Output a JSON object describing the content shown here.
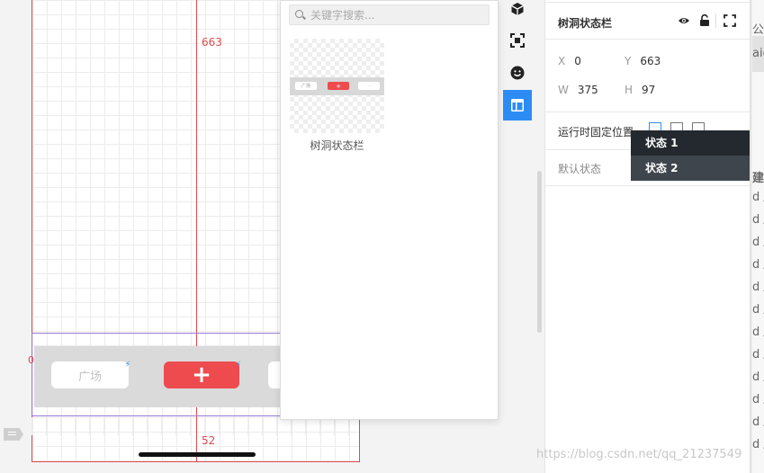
{
  "canvas": {
    "top_measure": "663",
    "bottom_measure": "52",
    "zero_mark": "0",
    "tabbar": {
      "left_label": "广场",
      "center_label": "+"
    }
  },
  "component_panel": {
    "search_placeholder": "关键字搜索...",
    "thumb_left": "广场",
    "thumb_center": "+",
    "thumb_right": "· · ·",
    "component_label": "树洞状态栏"
  },
  "rail": {
    "icons": [
      "cube-icon",
      "scan-icon",
      "smiley-icon",
      "layout-icon"
    ],
    "active": "layout-icon"
  },
  "properties": {
    "title": "树洞状态栏",
    "x_label": "X",
    "x_value": "0",
    "y_label": "Y",
    "y_value": "663",
    "w_label": "W",
    "w_value": "375",
    "h_label": "H",
    "h_value": "97",
    "fixed_position_label": "运行时固定位置",
    "default_state_label": "默认状态",
    "dropdown": [
      "状态 1",
      "状态 2"
    ]
  },
  "peek": {
    "rows": [
      "公",
      "aio",
      "建",
      "d /",
      "d /",
      "d /",
      "d /",
      "d /",
      "d /",
      "d /",
      "d /",
      "d /",
      "d /",
      "d /",
      "d /"
    ]
  },
  "watermark": "https://blog.csdn.net/qq_21237549"
}
